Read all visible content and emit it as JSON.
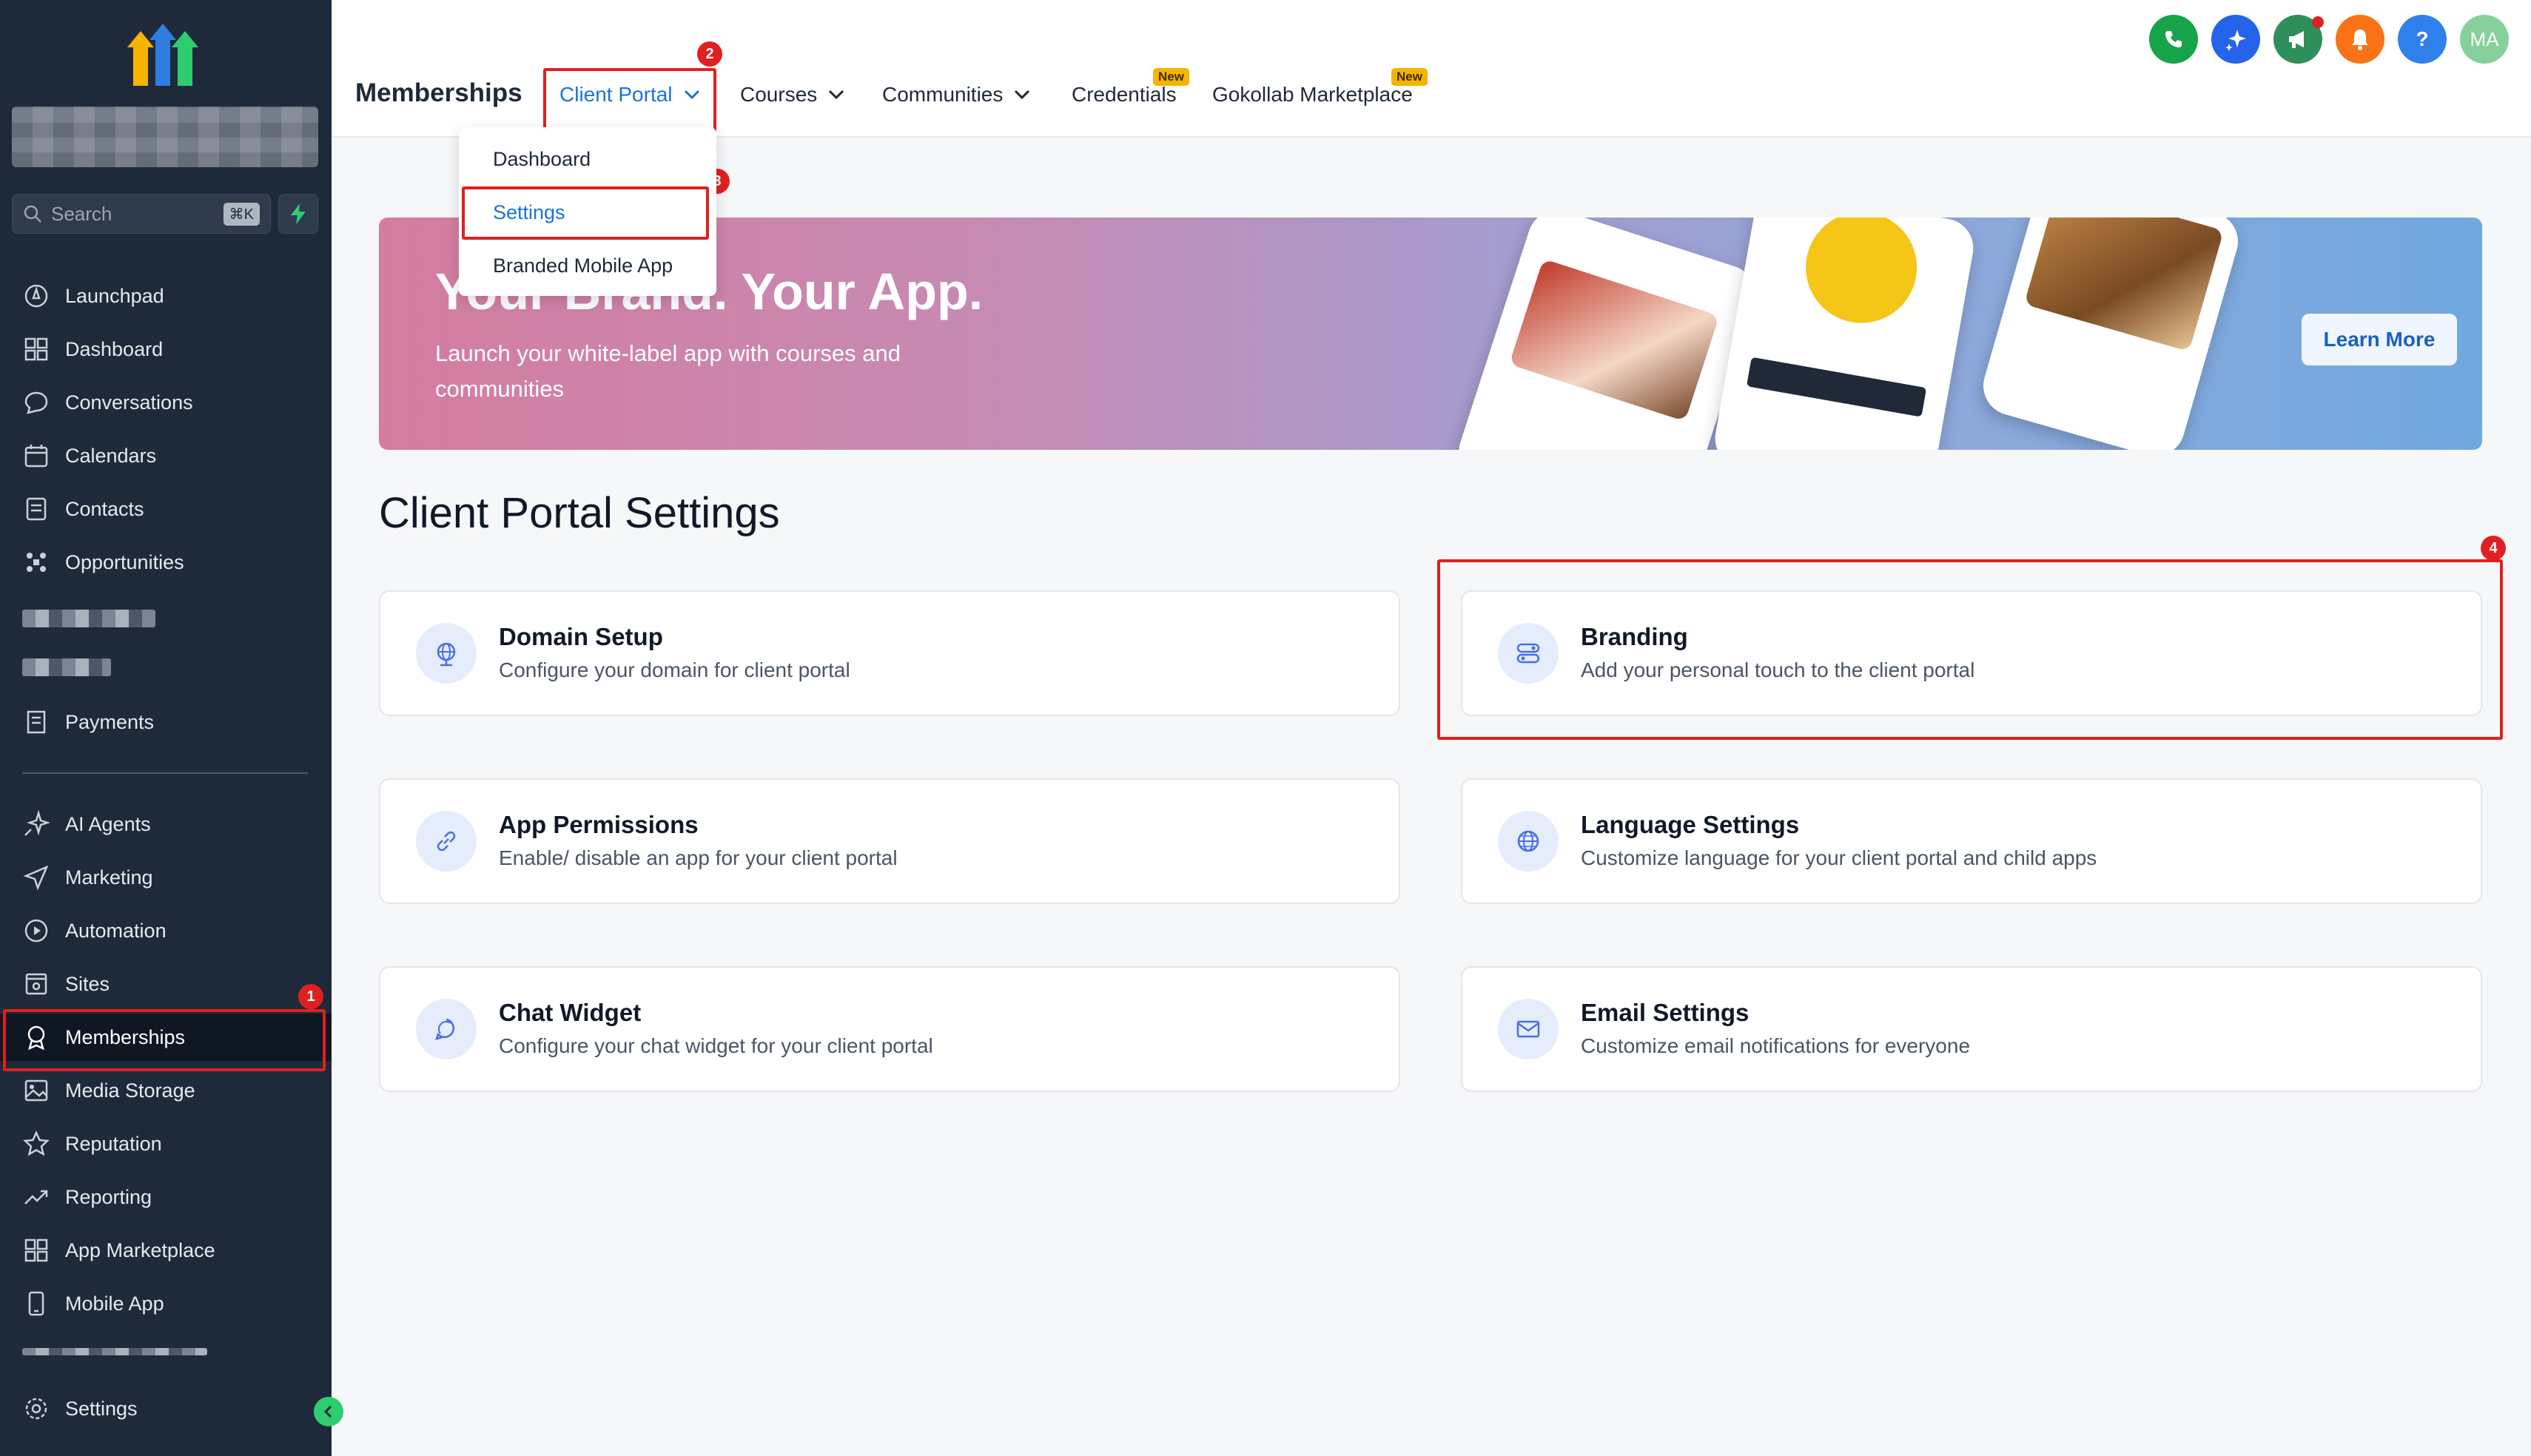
{
  "sidebar": {
    "search_label": "Search",
    "search_shortcut": "⌘K",
    "items": [
      {
        "label": "Launchpad",
        "icon": "rocket-icon"
      },
      {
        "label": "Dashboard",
        "icon": "grid-icon"
      },
      {
        "label": "Conversations",
        "icon": "chat-icon"
      },
      {
        "label": "Calendars",
        "icon": "calendar-icon"
      },
      {
        "label": "Contacts",
        "icon": "contacts-icon"
      },
      {
        "label": "Opportunities",
        "icon": "opportunities-icon"
      },
      {
        "label": "Payments",
        "icon": "payments-icon"
      },
      {
        "label": "AI Agents",
        "icon": "sparkle-icon"
      },
      {
        "label": "Marketing",
        "icon": "send-icon"
      },
      {
        "label": "Automation",
        "icon": "automation-icon"
      },
      {
        "label": "Sites",
        "icon": "sites-icon"
      },
      {
        "label": "Memberships",
        "icon": "membership-icon"
      },
      {
        "label": "Media Storage",
        "icon": "image-icon"
      },
      {
        "label": "Reputation",
        "icon": "star-icon"
      },
      {
        "label": "Reporting",
        "icon": "trend-icon"
      },
      {
        "label": "App Marketplace",
        "icon": "apps-icon"
      },
      {
        "label": "Mobile App",
        "icon": "mobile-icon"
      },
      {
        "label": "Settings",
        "icon": "gear-icon"
      }
    ],
    "active_item": "Memberships"
  },
  "annotations": [
    "1",
    "2",
    "3",
    "4"
  ],
  "header": {
    "title": "Memberships",
    "tabs": [
      {
        "label": "Client Portal",
        "dropdown": true,
        "active": true
      },
      {
        "label": "Courses",
        "dropdown": true
      },
      {
        "label": "Communities",
        "dropdown": true
      },
      {
        "label": "Credentials",
        "badge": "New"
      },
      {
        "label": "Gokollab Marketplace",
        "badge": "New"
      }
    ],
    "user_initials": "MA",
    "help_label": "?"
  },
  "dropdown": {
    "items": [
      "Dashboard",
      "Settings",
      "Branded Mobile App"
    ],
    "selected": "Settings"
  },
  "banner": {
    "title": "Your Brand. Your App.",
    "subtitle": "Launch your white-label app with courses and communities",
    "button": "Learn More"
  },
  "main": {
    "title": "Client Portal Settings",
    "cards": [
      {
        "title": "Domain Setup",
        "desc": "Configure your domain for client portal",
        "icon": "globe-icon"
      },
      {
        "title": "Branding",
        "desc": "Add your personal touch to the client portal",
        "icon": "branding-icon"
      },
      {
        "title": "App Permissions",
        "desc": "Enable/ disable an app for your client portal",
        "icon": "link-icon"
      },
      {
        "title": "Language Settings",
        "desc": "Customize language for your client portal and child apps",
        "icon": "language-icon"
      },
      {
        "title": "Chat Widget",
        "desc": "Configure your chat widget for your client portal",
        "icon": "chat-bubble-icon"
      },
      {
        "title": "Email Settings",
        "desc": "Customize email notifications for everyone",
        "icon": "mail-icon"
      }
    ]
  },
  "colors": {
    "sidebar_bg": "#1e2a3a",
    "accent": "#1a73d9",
    "annotation_red": "#e02020",
    "new_badge": "#f5b400"
  }
}
